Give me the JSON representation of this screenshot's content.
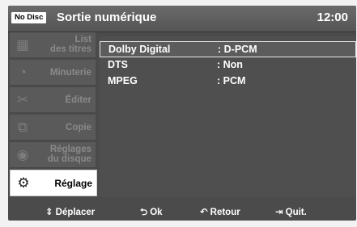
{
  "header": {
    "badge": "No Disc",
    "title": "Sortie numérique",
    "clock": "12:00"
  },
  "sidebar": {
    "items": [
      {
        "label": "List\ndes titres",
        "icon": "film-list-icon",
        "glyph": "▦"
      },
      {
        "label": "Minuterie",
        "icon": "timer-icon",
        "glyph": "◔"
      },
      {
        "label": "Éditer",
        "icon": "scissors-icon",
        "glyph": "✂"
      },
      {
        "label": "Copie",
        "icon": "copy-discs-icon",
        "glyph": "⧉"
      },
      {
        "label": "Réglages\ndu disque",
        "icon": "disc-settings-icon",
        "glyph": "◉"
      },
      {
        "label": "Réglage",
        "icon": "gear-icon",
        "glyph": "⚙"
      }
    ]
  },
  "settings": {
    "rows": [
      {
        "name": "Dolby Digital",
        "value": ": D-PCM"
      },
      {
        "name": "DTS",
        "value": ": Non"
      },
      {
        "name": "MPEG",
        "value": ": PCM"
      }
    ]
  },
  "footer": {
    "move": {
      "icon": "updown-arrows-icon",
      "glyph": "⇕",
      "label": "Déplacer"
    },
    "ok": {
      "icon": "enter-icon",
      "glyph": "⮌",
      "label": "Ok"
    },
    "back": {
      "icon": "return-arrow-icon",
      "glyph": "↶",
      "label": "Retour"
    },
    "quit": {
      "icon": "exit-icon",
      "glyph": "⇥",
      "label": "Quit."
    }
  }
}
